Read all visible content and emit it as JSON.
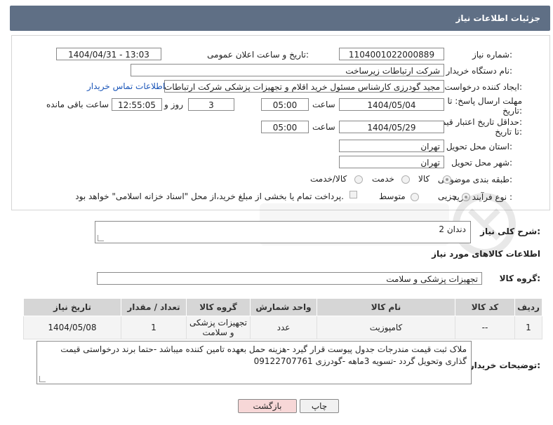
{
  "header": {
    "title": "جزئیات اطلاعات نیاز"
  },
  "form": {
    "need_number": {
      "label": "شماره نیاز:",
      "value": "1104001022000889"
    },
    "announce_datetime": {
      "label": "تاریخ و ساعت اعلان عمومی:",
      "value": "1404/04/31 - 13:03"
    },
    "buyer_org": {
      "label": "نام دستگاه خریدار:",
      "value": "شرکت ارتباطات زیرساخت"
    },
    "requester": {
      "label": "ایجاد کننده درخواست:",
      "value": "مجید گودرزی کارشناس مسئول خرید اقلام و تجهیزات پزشکی شرکت ارتباطات ز",
      "contact_link": "اطلاعات تماس خریدار"
    },
    "reply_deadline": {
      "label_line1": "مهلت ارسال پاسخ: تا",
      "label_line2": "تاریخ:",
      "date": "1404/05/04",
      "time_label": "ساعت",
      "time": "05:00",
      "days": "3",
      "days_label": "روز و",
      "remaining": "12:55:05",
      "remaining_label": "ساعت باقی مانده"
    },
    "price_validity": {
      "label_line1": "حداقل تاریخ اعتبار قیمت:",
      "label_line2": "تا تاریخ:",
      "date": "1404/05/29",
      "time_label": "ساعت",
      "time": "05:00"
    },
    "delivery_province": {
      "label": "استان محل تحویل:",
      "value": "تهران"
    },
    "delivery_city": {
      "label": "شهر محل تحویل:",
      "value": "تهران"
    },
    "category": {
      "label": "طبقه بندی موضوعی:",
      "options": [
        "کالا",
        "خدمت",
        "کالا/خدمت"
      ],
      "selected": "کالا"
    },
    "process_type": {
      "label": "نوع فرآیند خرید :",
      "options": [
        "جزیی",
        "متوسط"
      ],
      "selected": "جزیی",
      "payment_note": "پرداخت تمام یا بخشی از مبلغ خرید،از محل \"اسناد خزانه اسلامی\" خواهد بود."
    }
  },
  "summary": {
    "label": "شرح کلی نیاز:",
    "value": "دندان 2"
  },
  "goods_info": {
    "title": "اطلاعات کالاهای مورد نیاز"
  },
  "goods_group": {
    "label": "گروه کالا:",
    "value": "تجهیزات پزشکی و سلامت"
  },
  "table": {
    "headers": [
      "ردیف",
      "کد کالا",
      "نام کالا",
      "واحد شمارش",
      "گروه کالا",
      "تعداد / مقدار",
      "تاریخ نیاز"
    ],
    "rows": [
      {
        "row": "1",
        "code": "--",
        "name": "کامپوزیت",
        "unit": "عدد",
        "group": "تجهیزات پزشکی و سلامت",
        "qty": "1",
        "date": "1404/05/08"
      }
    ]
  },
  "buyer_notes": {
    "label": "توضیحات خریدار:",
    "value": "ملاک ثبت قیمت مندرجات جدول پیوست قرار گیرد -هزینه حمل بعهده تامین کننده میباشد -حتما برند درخواستی قیمت گذاری وتحویل گردد -تسویه 3ماهه -گودرزی 09122707761"
  },
  "buttons": {
    "print": "چاپ",
    "back": "بازگشت"
  },
  "colors": {
    "header_bg": "#5f6f85",
    "link": "#1a55b8",
    "print_btn": "#f1f1f1",
    "back_btn": "#f7d7d7"
  }
}
